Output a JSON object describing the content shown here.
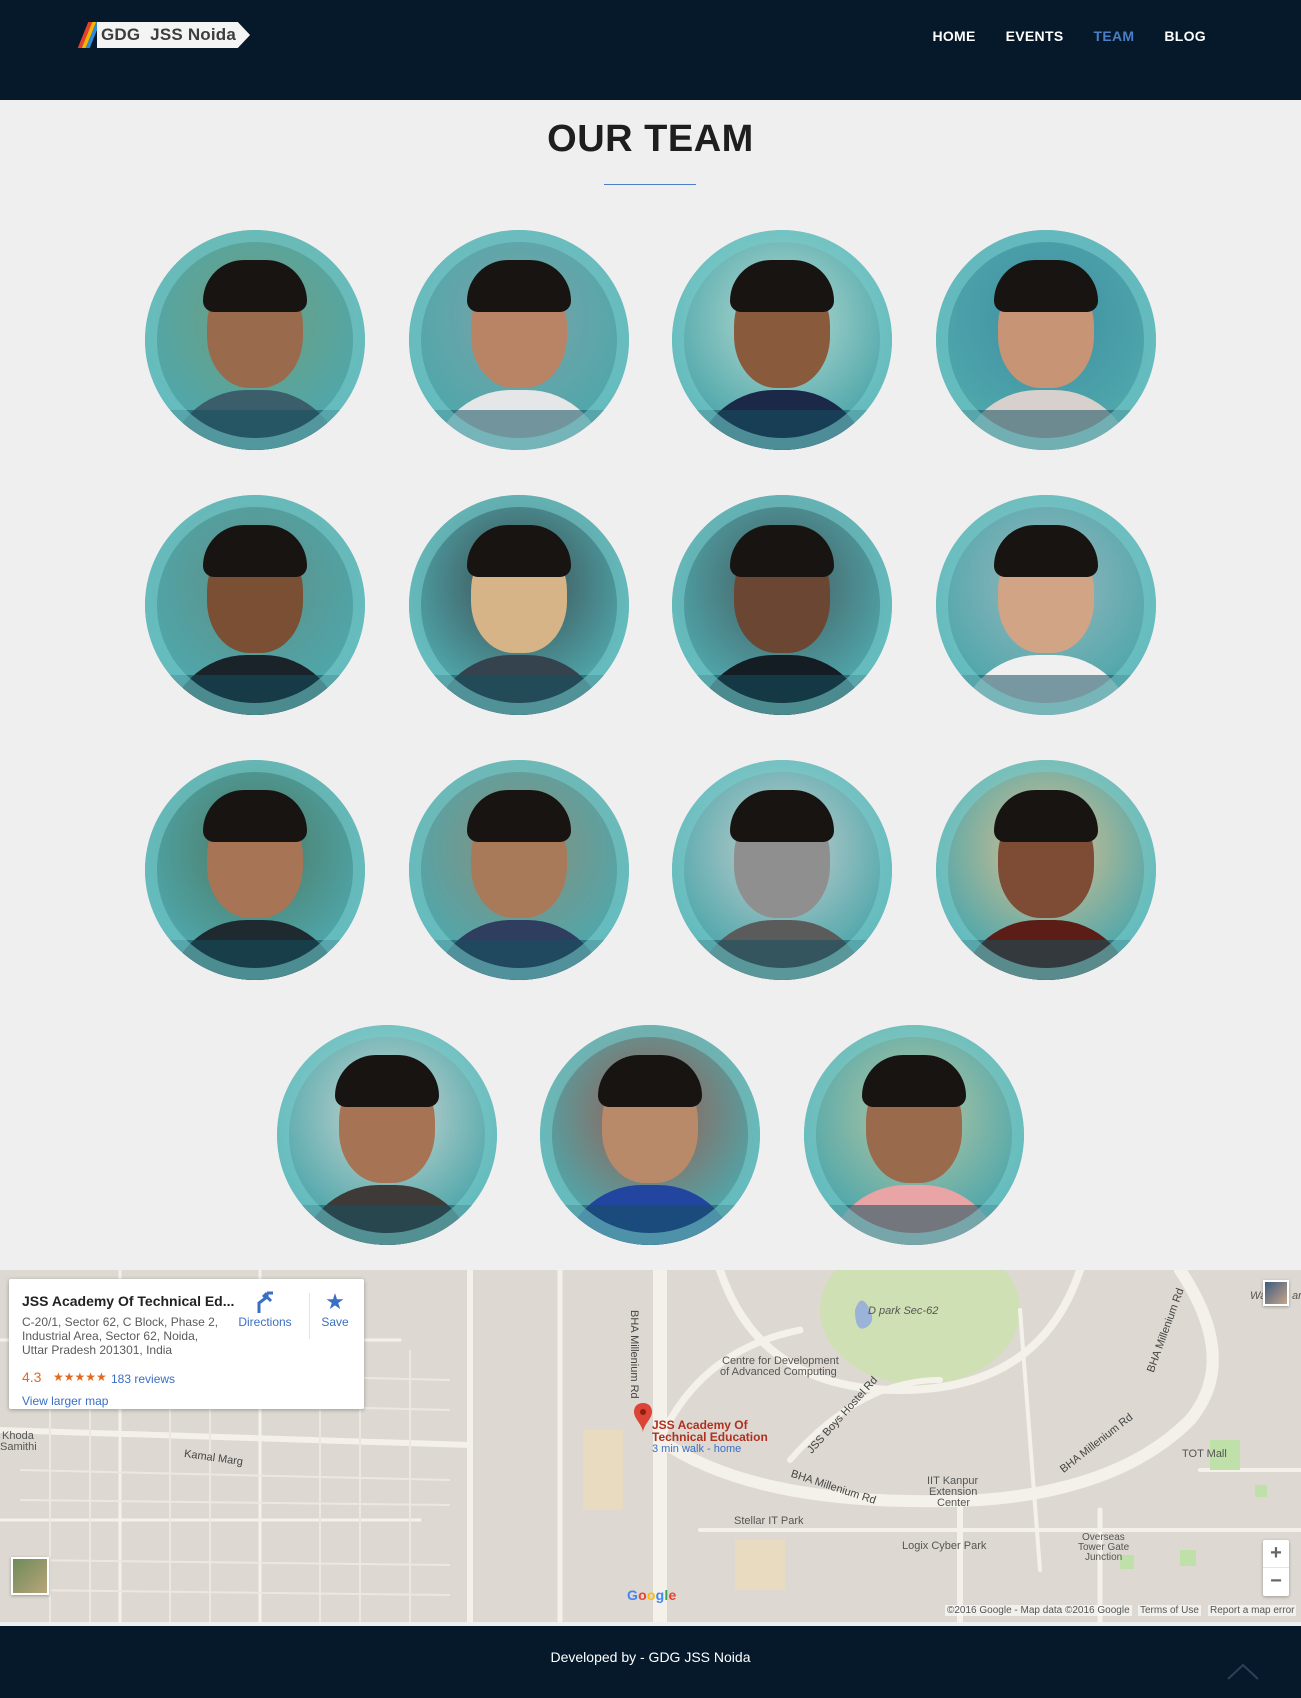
{
  "header": {
    "logo_text": "GDG  JSS Noida",
    "nav": [
      {
        "label": "HOME",
        "active": false
      },
      {
        "label": "EVENTS",
        "active": false
      },
      {
        "label": "TEAM",
        "active": true
      },
      {
        "label": "BLOG",
        "active": false
      }
    ]
  },
  "team": {
    "title": "OUR TEAM",
    "members": [
      {
        "skin": "#9a6a4c",
        "shirt": "#3c5d6a",
        "bg": "#6f9e7e"
      },
      {
        "skin": "#b98465",
        "shirt": "#e4e6e8",
        "bg": "#7aa3a7"
      },
      {
        "skin": "#8a5a3c",
        "shirt": "#1b2847",
        "bg": "#b9dcd2"
      },
      {
        "skin": "#c89476",
        "shirt": "#d7d0cc",
        "bg": "#3e8fa2"
      },
      {
        "skin": "#7a4f34",
        "shirt": "#1a2329",
        "bg": "#5e8f86"
      },
      {
        "skin": "#d6b487",
        "shirt": "#35434f",
        "bg": "#3c4a4e"
      },
      {
        "skin": "#6b4632",
        "shirt": "#151d24",
        "bg": "#465a5e"
      },
      {
        "skin": "#d2a486",
        "shirt": "#f0f0f0",
        "bg": "#98b7bd"
      },
      {
        "skin": "#a77555",
        "shirt": "#1e2a30",
        "bg": "#4c7760"
      },
      {
        "skin": "#a87a5a",
        "shirt": "#2f3e5e",
        "bg": "#8a8e7c"
      },
      {
        "skin": "#8f8f8f",
        "shirt": "#5b5b5b",
        "bg": "#c8cfcf"
      },
      {
        "skin": "#7e4b34",
        "shirt": "#5c1d16",
        "bg": "#e0c08c"
      },
      {
        "skin": "#a67455",
        "shirt": "#3e3a38",
        "bg": "#cfd7d2"
      },
      {
        "skin": "#b88a6a",
        "shirt": "#2245a0",
        "bg": "#9a5a4c"
      },
      {
        "skin": "#9a6a4c",
        "shirt": "#e9a5a5",
        "bg": "#b9c7a1"
      }
    ]
  },
  "map": {
    "card": {
      "title": "JSS Academy Of Technical Ed...",
      "address": "C-20/1, Sector 62, C Block, Phase 2, Industrial Area, Sector 62, Noida, Uttar Pradesh 201301, India",
      "rating": "4.3",
      "stars": "★★★★★",
      "reviews": "183 reviews",
      "view_larger": "View larger map",
      "directions": "Directions",
      "save": "Save"
    },
    "labels": {
      "place_line1": "JSS Academy Of",
      "place_line2": "Technical Education",
      "walk": "3 min walk - home",
      "cdac1": "Centre for Development",
      "cdac2": "of Advanced Computing",
      "dpark": "D park Sec-62",
      "bha1": "BHA Millenium Rd",
      "bha2": "BHA Millenium Rd",
      "bha3": "BHA Millenium Rd",
      "bha4": "BHA Millenium Rd",
      "jss_hostel": "JSS Boys Hostel Rd",
      "kamal": "Kamal Marg",
      "khoda1": "Khoda",
      "khoda2": "Samithi",
      "iit1": "IIT Kanpur",
      "iit2": "Extension",
      "iit3": "Center",
      "stellar": "Stellar IT Park",
      "logix": "Logix Cyber Park",
      "tot": "TOT Mall",
      "overseas1": "Overseas",
      "overseas2": "Tower Gate",
      "overseas3": "Junction",
      "wa": "Wa",
      "ar": "ar"
    },
    "footer": {
      "copyright": "©2016 Google - Map data ©2016 Google",
      "terms": "Terms of Use",
      "report": "Report a map error",
      "google": "Google"
    },
    "zoom_in": "+",
    "zoom_out": "−"
  },
  "footer": {
    "text": "Developed by - GDG JSS Noida"
  },
  "colors": {
    "navbar_bg": "#05192b",
    "accent": "#4a7fc4",
    "page_bg": "#efefef"
  }
}
